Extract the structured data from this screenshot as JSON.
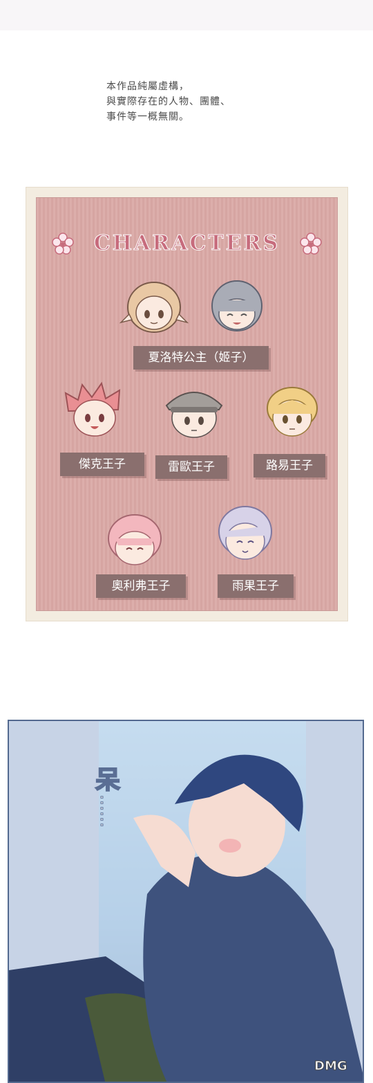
{
  "disclaimer": {
    "line1": "本作品純屬虛構，",
    "line2": "與實際存在的人物、團體、",
    "line3": "事件等一概無關。"
  },
  "characters": {
    "title": "CHARACTERS",
    "main": "夏洛特公主（姬子）",
    "jack": "傑克王子",
    "leo": "雷歐王子",
    "louis": "路易王子",
    "oliver": "奧利弗王子",
    "hugo": "雨果王子"
  },
  "panel": {
    "sfx": "呆",
    "ellipsis": "……",
    "watermark": "DMG"
  },
  "colors": {
    "card_bg": "#dcaeab",
    "label_bg": "#8a6f6e",
    "title": "#c76c7d",
    "panel_sky": "#93b0d6"
  }
}
